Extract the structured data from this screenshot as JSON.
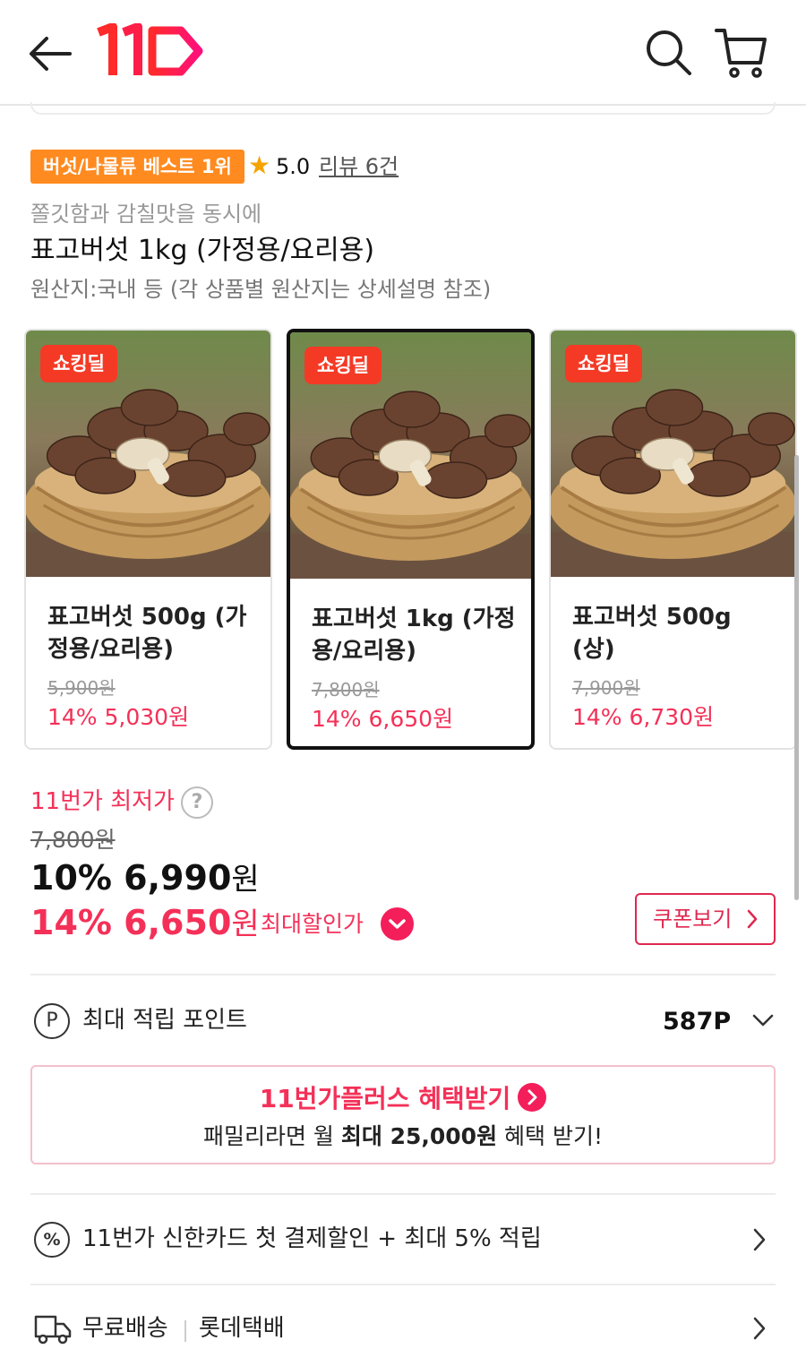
{
  "header": {
    "back_icon": "arrow-left-icon",
    "logo_text": "11",
    "search_icon": "search-icon",
    "cart_icon": "cart-icon",
    "brand_color": "#ff0f4c"
  },
  "product": {
    "best_badge": "버섯/나물류 베스트 1위",
    "rating": "5.0",
    "review_link": "리뷰 6건",
    "subtitle": "쫄깃함과 감칠맛을 동시에",
    "title": "표고버섯 1kg (가정용/요리용)",
    "origin": "원산지:국내 등 (각 상품별 원산지는 상세설명 참조)"
  },
  "options": [
    {
      "badge": "쇼킹딜",
      "name": "표고버섯 500g (가정용/요리용)",
      "original_price": "5,900원",
      "price": "14% 5,030원",
      "selected": false
    },
    {
      "badge": "쇼킹딜",
      "name": "표고버섯 1kg (가정용/요리용)",
      "original_price": "7,800원",
      "price": "14% 6,650원",
      "selected": true
    },
    {
      "badge": "쇼킹딜",
      "name": "표고버섯 500g (상)",
      "original_price": "7,900원",
      "price": "14% 6,730원",
      "selected": false
    }
  ],
  "price": {
    "lowest_label": "11번가 최저가",
    "help": "?",
    "original": "7,800원",
    "sale_amount": "10% 6,990",
    "won": "원",
    "max_amount": "14% 6,650",
    "max_label": "최대할인가",
    "coupon_button": "쿠폰보기",
    "accent_color": "#f43058"
  },
  "points": {
    "icon": "P",
    "label": "최대 적립 포인트",
    "value": "587P"
  },
  "plus": {
    "title": "11번가플러스 혜택받기",
    "sub_prefix": "패밀리라면 월 ",
    "sub_bold": "최대 25,000원",
    "sub_suffix": " 혜택 받기!"
  },
  "card_promo": {
    "icon": "%",
    "text": "11번가 신한카드 첫 결제할인 + 최대 5% 적립"
  },
  "shipping": {
    "icon": "truck-icon",
    "label": "무료배송",
    "carrier": "롯데택배"
  }
}
